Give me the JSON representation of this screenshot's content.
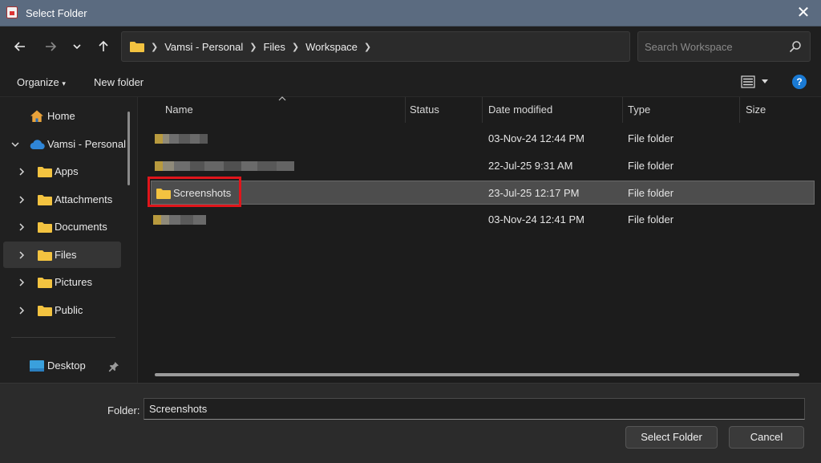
{
  "window": {
    "title": "Select Folder"
  },
  "address": {
    "crumbs": [
      "Vamsi - Personal",
      "Files",
      "Workspace"
    ]
  },
  "search": {
    "placeholder": "Search Workspace"
  },
  "commands": {
    "organize": "Organize",
    "new_folder": "New folder"
  },
  "nav": {
    "items": [
      {
        "label": "Home"
      },
      {
        "label": "Vamsi - Personal"
      },
      {
        "label": "Apps"
      },
      {
        "label": "Attachments"
      },
      {
        "label": "Documents"
      },
      {
        "label": "Files"
      },
      {
        "label": "Pictures"
      },
      {
        "label": "Public"
      },
      {
        "label": "Desktop"
      }
    ]
  },
  "columns": {
    "name": "Name",
    "status": "Status",
    "date_modified": "Date modified",
    "type": "Type",
    "size": "Size"
  },
  "rows": [
    {
      "name": "",
      "date": "03-Nov-24 12:44 PM",
      "type": "File folder"
    },
    {
      "name": "",
      "date": "22-Jul-25 9:31 AM",
      "type": "File folder"
    },
    {
      "name": "Screenshots",
      "date": "23-Jul-25 12:17 PM",
      "type": "File folder"
    },
    {
      "name": "",
      "date": "03-Nov-24 12:41 PM",
      "type": "File folder"
    }
  ],
  "footer": {
    "folder_label": "Folder:",
    "folder_value": "Screenshots",
    "select_button": "Select Folder",
    "cancel_button": "Cancel"
  },
  "colors": {
    "titlebar": "#5b6b80",
    "folder": "#f3c340",
    "highlight": "#e0151b",
    "help": "#1a7ad4"
  }
}
